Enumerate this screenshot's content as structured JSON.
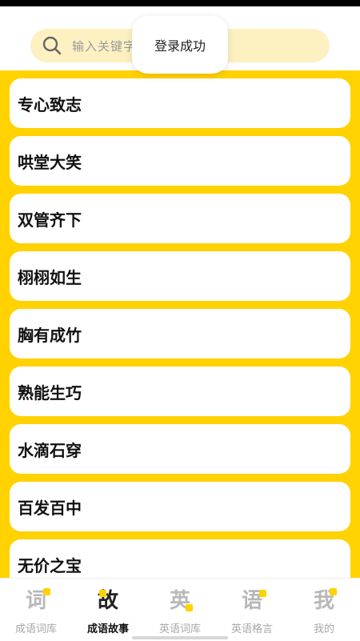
{
  "search": {
    "placeholder": "输入关键字"
  },
  "toast": {
    "message": "登录成功"
  },
  "idioms": [
    "专心致志",
    "哄堂大笑",
    "双管齐下",
    "栩栩如生",
    "胸有成竹",
    "熟能生巧",
    "水滴石穿",
    "百发百中",
    "无价之宝"
  ],
  "tabs": [
    {
      "glyph": "词",
      "label": "成语词库",
      "active": false
    },
    {
      "glyph": "故",
      "label": "成语故事",
      "active": true
    },
    {
      "glyph": "英",
      "label": "英语词库",
      "active": false
    },
    {
      "glyph": "语",
      "label": "英语格言",
      "active": false
    },
    {
      "glyph": "我",
      "label": "我的",
      "active": false
    }
  ],
  "colors": {
    "accent": "#ffd200",
    "search_bg": "#fdf1c2"
  }
}
